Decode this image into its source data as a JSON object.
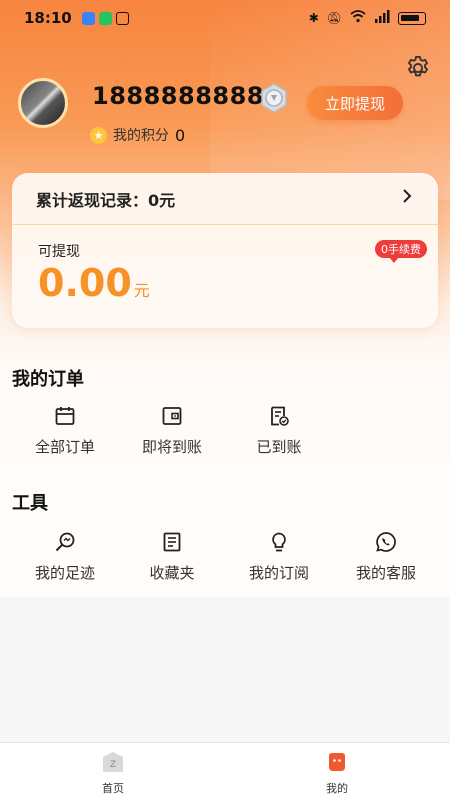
{
  "status_bar": {
    "time": "18:10"
  },
  "profile": {
    "phone": "18888888888",
    "points_label": "我的积分",
    "points_value": "0"
  },
  "cashback_card": {
    "record_label": "累计返现记录：0元",
    "withdrawable_label": "可提现",
    "amount": "0.00",
    "unit": "元",
    "withdraw_button": "立即提现",
    "fee_tag": "0手续费"
  },
  "orders": {
    "title": "我的订单",
    "items": [
      {
        "label": "全部订单",
        "icon": "calendar-icon"
      },
      {
        "label": "即将到账",
        "icon": "wallet-icon"
      },
      {
        "label": "已到账",
        "icon": "receipt-check-icon"
      }
    ]
  },
  "tools": {
    "title": "工具",
    "items": [
      {
        "label": "我的足迹",
        "icon": "footprint-search-icon"
      },
      {
        "label": "收藏夹",
        "icon": "bookmark-list-icon"
      },
      {
        "label": "我的订阅",
        "icon": "lightbulb-icon"
      },
      {
        "label": "我的客服",
        "icon": "chat-phone-icon"
      }
    ]
  },
  "tabbar": {
    "tabs": [
      {
        "label": "首页",
        "icon": "home-icon"
      },
      {
        "label": "我的",
        "icon": "mine-icon"
      }
    ]
  },
  "colors": {
    "accent": "#f36f3a",
    "amount": "#f79226",
    "fee_tag": "#ee3b3b"
  }
}
